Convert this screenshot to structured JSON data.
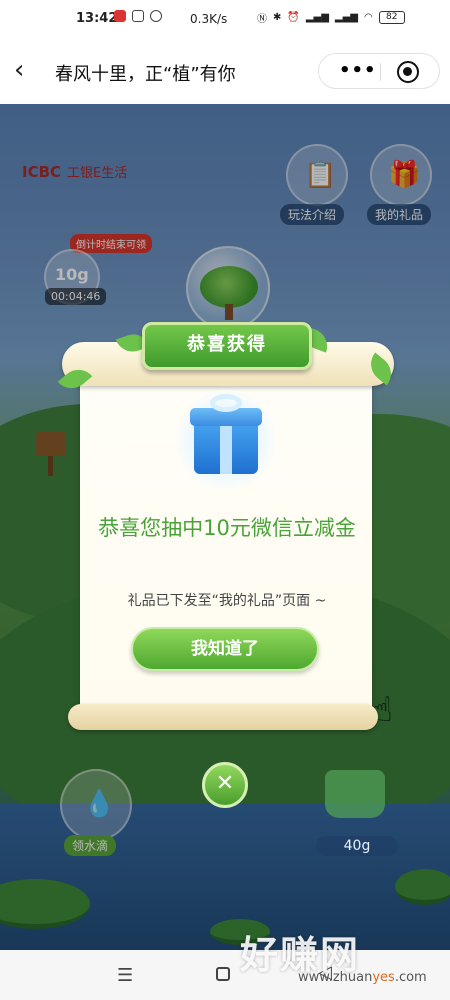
{
  "status_bar": {
    "time": "13:42",
    "speed": "0.3K/s",
    "battery": "82"
  },
  "title_bar": {
    "title": "春风十里，正“植”有你",
    "more_icon": "more-dots-icon",
    "target_icon": "close-miniprogram-icon"
  },
  "scene": {
    "brand": "ICBC",
    "brand_cn": "工银E生活",
    "gameplay_label": "玩法介绍",
    "gifts_label": "我的礼品",
    "timer_tag": "倒计时结束可领",
    "timer_grams": "10g",
    "timer_countdown": "00:04:46",
    "collect_water_label": "领水滴",
    "water_amount": "40g"
  },
  "modal": {
    "ribbon_title": "恭喜获得",
    "prize_text": "恭喜您抽中10元微信立减金",
    "sub_text": "礼品已下发至“我的礼品”页面 ~",
    "ok_button": "我知道了",
    "close_icon": "close-icon"
  },
  "watermark": {
    "text": "好赚网",
    "url_prefix": "www.zhuan",
    "url_highlight": "yes",
    "url_suffix": ".com"
  },
  "colors": {
    "accent_green": "#4ea82f",
    "prize_text_green": "#4aa23a",
    "brand_red": "#a92a2a"
  }
}
